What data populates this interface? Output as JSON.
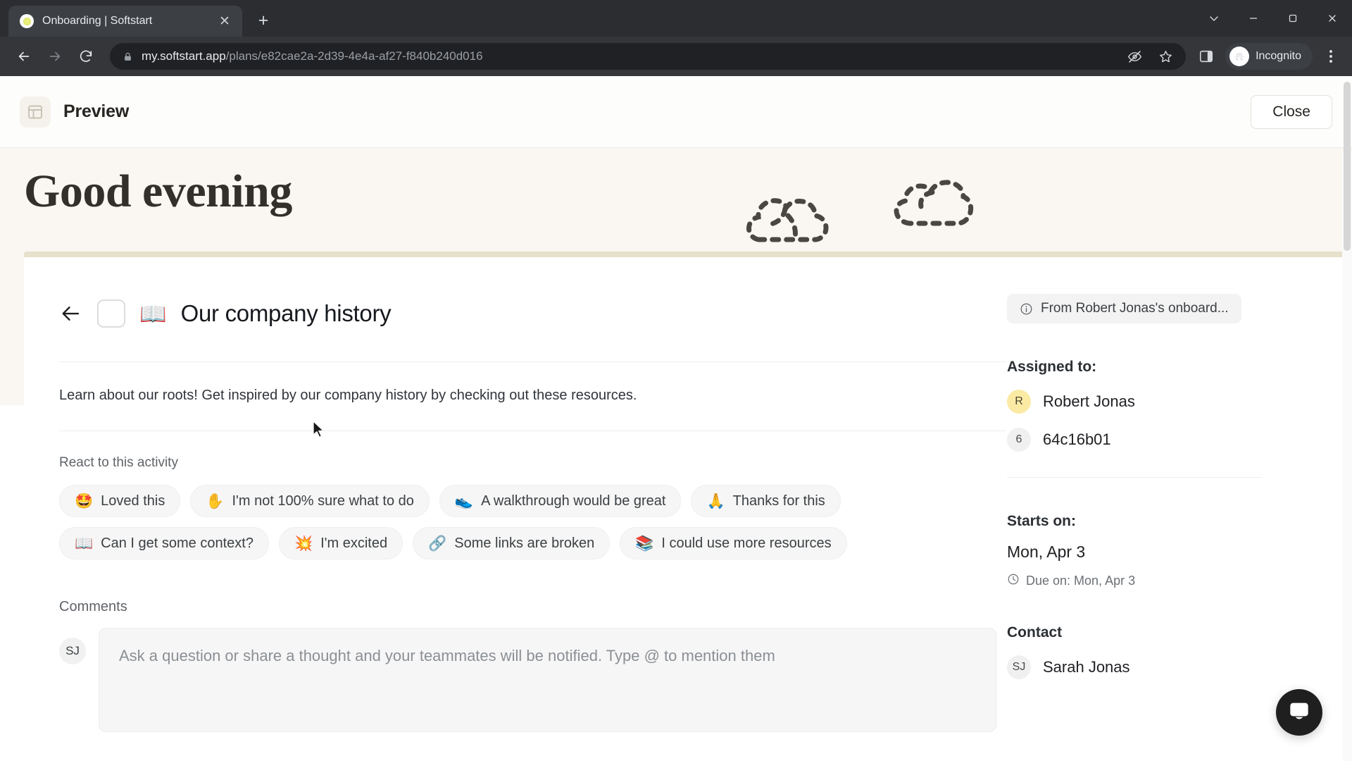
{
  "browser": {
    "tab": {
      "title": "Onboarding | Softstart",
      "favicon": "softstart-dot-icon",
      "close": "✕"
    },
    "new_tab": "+",
    "window_controls": {
      "minimize_group": "chevron-down-icon",
      "minimize": "minimize-icon",
      "maximize": "maximize-icon",
      "close": "close-icon"
    },
    "nav": {
      "back": "back-arrow-icon",
      "forward": "forward-arrow-icon",
      "reload": "reload-icon"
    },
    "omnibox": {
      "lock": "lock-icon",
      "url_domain": "my.softstart.app",
      "url_path": "/plans/e82cae2a-2d39-4e4a-af27-f840b240d016",
      "third_party_cookies": "eye-crossed-icon",
      "bookmark": "star-icon"
    },
    "side_panel": "side-panel-icon",
    "profile": {
      "label": "Incognito",
      "icon": "incognito-hat-icon"
    },
    "menu": "kebab-menu-icon"
  },
  "app": {
    "header": {
      "icon": "layout-preview-icon",
      "title": "Preview",
      "close_label": "Close"
    },
    "hero": {
      "greeting": "Good evening"
    },
    "activity": {
      "back": "back-arrow-icon",
      "checkbox": "activity-checkbox",
      "emoji": "📖",
      "title": "Our company history",
      "description": "Learn about our roots! Get inspired by our company history by checking out these resources."
    },
    "reactions": {
      "label": "React to this activity",
      "chips": [
        {
          "emoji": "🤩",
          "label": "Loved this"
        },
        {
          "emoji": "✋",
          "label": "I'm not 100% sure what to do"
        },
        {
          "emoji": "👟",
          "label": "A walkthrough would be great"
        },
        {
          "emoji": "🙏",
          "label": "Thanks for this"
        },
        {
          "emoji": "📖",
          "label": "Can I get some context?"
        },
        {
          "emoji": "💥",
          "label": "I'm excited"
        },
        {
          "emoji": "🔗",
          "label": "Some links are broken"
        },
        {
          "emoji": "📚",
          "label": "I could use more resources"
        }
      ]
    },
    "comments": {
      "label": "Comments",
      "avatar_initials": "SJ",
      "placeholder": "Ask a question or share a thought and your teammates will be notified. Type @ to mention them"
    },
    "sidebar": {
      "from_pill": {
        "icon": "info-icon",
        "label": "From Robert Jonas's onboard..."
      },
      "assigned_heading": "Assigned to:",
      "assignees": [
        {
          "initial": "R",
          "name": "Robert Jonas",
          "avatar_color": "#fbeaa4"
        },
        {
          "initial": "6",
          "name": "64c16b01",
          "avatar_color": "#f0f0f0"
        }
      ],
      "starts_heading": "Starts on:",
      "start_date": "Mon, Apr 3",
      "due_icon": "clock-icon",
      "due_text": "Due on: Mon, Apr 3",
      "contact_heading": "Contact",
      "contact": {
        "initials": "SJ",
        "name": "Sarah Jonas"
      }
    },
    "intercom": "messenger-icon"
  },
  "colors": {
    "hero_bg": "#faf6f1",
    "hero_rule": "#e6e0cc",
    "accent_yellow": "#fbeaa4",
    "chip_bg": "#f6f6f6",
    "browser_dark": "#35363a"
  }
}
